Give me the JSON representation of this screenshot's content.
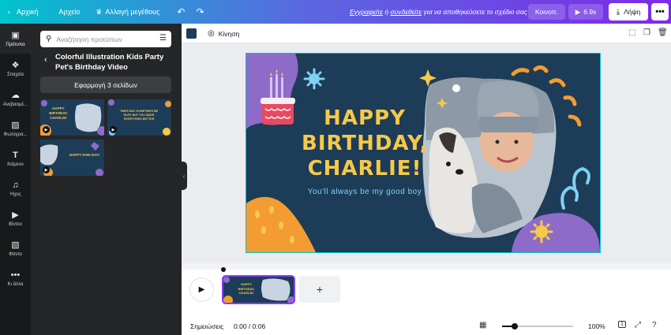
{
  "topbar": {
    "home": "Αρχική",
    "file": "Αρχείο",
    "resize": "Αλλαγή μεγέθους",
    "signup_pre": "Εγγραφείτε",
    "signup_or": " ή ",
    "signup_login": "συνδεθείτε",
    "signup_post": " για να αποθηκεύσετε το σχέδιο σας",
    "share": "Κοινοπ.",
    "duration": "6.9s",
    "download": "Λήψη"
  },
  "rail": [
    {
      "label": "Πρότυπα",
      "icon": "templates-icon"
    },
    {
      "label": "Στοιχεία",
      "icon": "elements-icon"
    },
    {
      "label": "Ανεβασμέ...",
      "icon": "uploads-icon"
    },
    {
      "label": "Φωτογρα...",
      "icon": "photos-icon"
    },
    {
      "label": "Κείμενο",
      "icon": "text-icon"
    },
    {
      "label": "Ήχος",
      "icon": "audio-icon"
    },
    {
      "label": "Βίντεο",
      "icon": "video-icon"
    },
    {
      "label": "Φόντο",
      "icon": "background-icon"
    },
    {
      "label": "Κι άλλα",
      "icon": "more-icon"
    }
  ],
  "panel": {
    "search_placeholder": "Αναζήτηση προτύπων",
    "template_title": "Colorful Illustration Kids Party Pet's Birthday Video",
    "apply_label": "Εφαρμογή 3 σελίδων",
    "thumbs": [
      {
        "text": "HAPPY BIRTHDAY, CHARLIE!"
      },
      {
        "text": "TIMES MAY SOMETIMES BE RUFF, BUT YOU MAKE EVERYTHING BETTER"
      },
      {
        "text": "HAPPY PAW-DAY!"
      }
    ]
  },
  "editor": {
    "animate": "Κίνηση",
    "color": "#1d3c58"
  },
  "canvas": {
    "line1": "HAPPY",
    "line2": "BIRTHDAY,",
    "line3": "CHARLIE!",
    "subtitle": "You'll always be my good boy"
  },
  "bottom": {
    "notes": "Σημειώσεις",
    "time": "0:00 / 0:06",
    "zoom": "100%",
    "page_number": "1",
    "zoom_level": 0.18
  },
  "colors": {
    "accent": "#8b3dff",
    "yellow": "#f7c948",
    "navy": "#1d3c58",
    "cyan": "#7fd1f2"
  }
}
